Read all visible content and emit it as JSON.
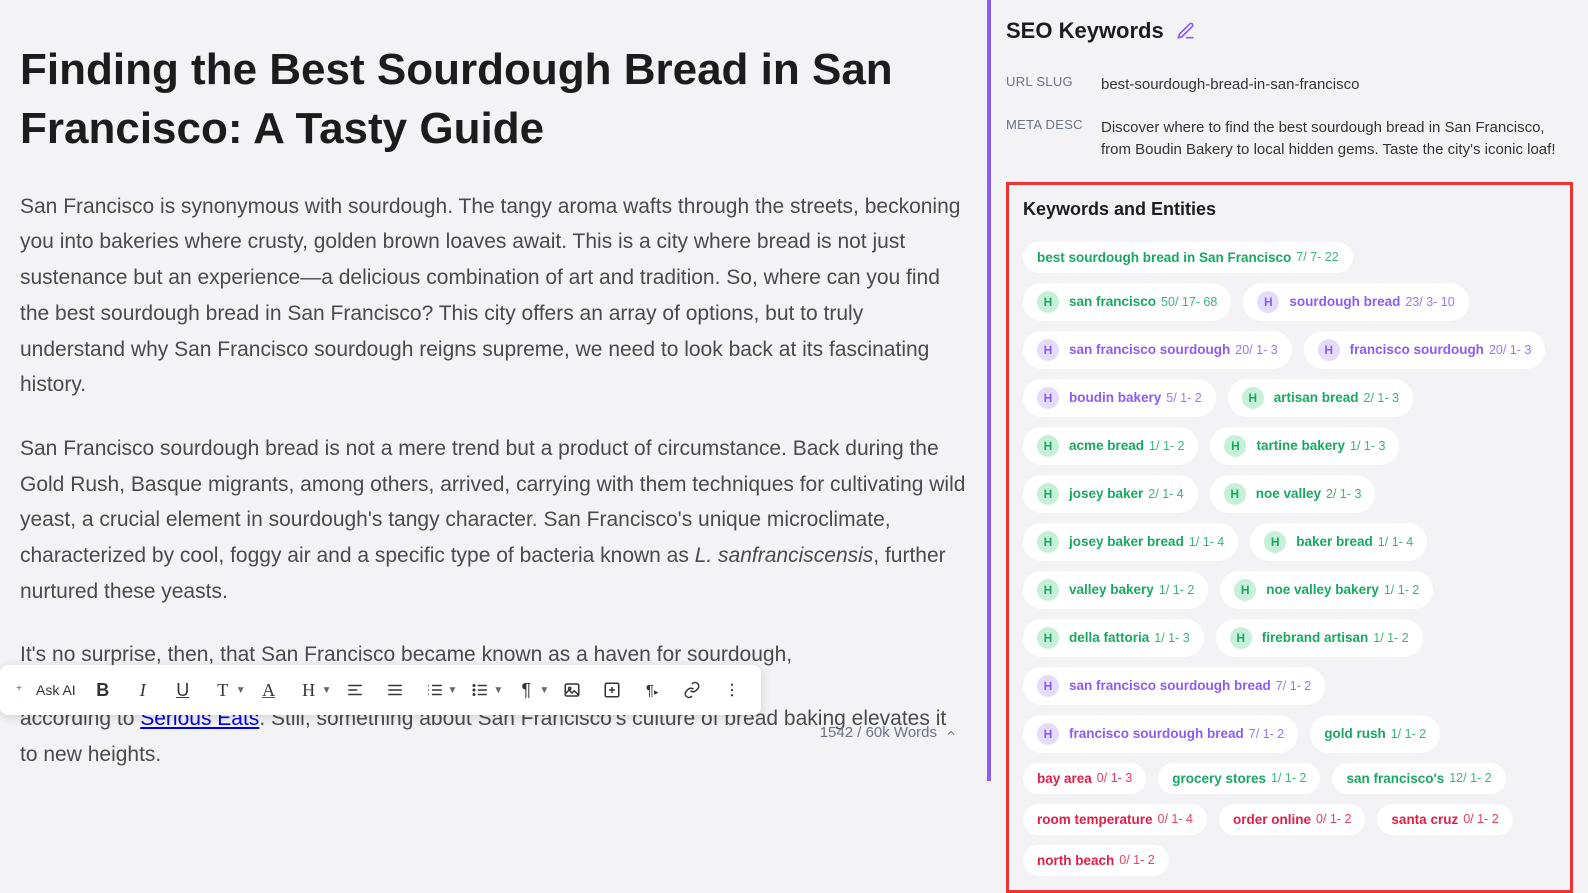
{
  "article": {
    "title": "Finding the Best Sourdough Bread in San Francisco: A Tasty Guide",
    "p1": "San Francisco is synonymous with sourdough. The tangy aroma wafts through the streets, beckoning you into bakeries where crusty, golden brown loaves await. This is a city where bread is not just sustenance but an experience—a delicious combination of art and tradition. So, where can you find the best sourdough bread in San Francisco? This city offers an array of options, but to truly understand why San Francisco sourdough reigns supreme, we need to look back at its fascinating history.",
    "p2a": "San Francisco sourdough bread is not a mere trend but a product of circumstance. Back during the Gold Rush, Basque migrants, among others, arrived, carrying with them techniques for cultivating wild yeast, a crucial element in sourdough's tangy character. San Francisco's unique microclimate, characterized by cool, foggy air and a specific type of bacteria known as ",
    "p2species": "L. sanfranciscensis",
    "p2b": ", further nurtured these yeasts.",
    "p3a": "It's no surprise, then, that San Francisco became known as a haven for sourdough,",
    "p3cut_a": "according to ",
    "p3link": "Serious Eats",
    "p3cut_b": ". Still, something about San Francisco's culture of bread baking elevates it to new heights."
  },
  "toolbar": {
    "ask_ai": "Ask AI",
    "bold": "B",
    "italic": "I",
    "underline": "U",
    "text_style": "T",
    "font": "A",
    "heading": "H",
    "pilcrow": "¶"
  },
  "word_count": "1542 / 60k Words",
  "seo": {
    "title": "SEO Keywords",
    "url_slug_label": "URL SLUG",
    "url_slug": "best-sourdough-bread-in-san-francisco",
    "meta_desc_label": "META DESC",
    "meta_desc": "Discover where to find the best sourdough bread in San Francisco, from Boudin Bakery to local hidden gems. Taste the city's iconic loaf!",
    "kw_title": "Keywords and Entities"
  },
  "keywords": [
    {
      "h": false,
      "c": "green",
      "term": "best sourdough bread in San Francisco",
      "stats": "7/ 7- 22"
    },
    {
      "h": true,
      "c": "green",
      "term": "san francisco",
      "stats": "50/ 17- 68"
    },
    {
      "h": true,
      "c": "purple",
      "term": "sourdough bread",
      "stats": "23/ 3- 10"
    },
    {
      "h": true,
      "c": "purple",
      "term": "san francisco sourdough",
      "stats": "20/ 1- 3"
    },
    {
      "h": true,
      "c": "purple",
      "term": "francisco sourdough",
      "stats": "20/ 1- 3"
    },
    {
      "h": true,
      "c": "purple",
      "term": "boudin bakery",
      "stats": "5/ 1- 2"
    },
    {
      "h": true,
      "c": "green",
      "term": "artisan bread",
      "stats": "2/ 1- 3"
    },
    {
      "h": true,
      "c": "green",
      "term": "acme bread",
      "stats": "1/ 1- 2"
    },
    {
      "h": true,
      "c": "green",
      "term": "tartine bakery",
      "stats": "1/ 1- 3"
    },
    {
      "h": true,
      "c": "green",
      "term": "josey baker",
      "stats": "2/ 1- 4"
    },
    {
      "h": true,
      "c": "green",
      "term": "noe valley",
      "stats": "2/ 1- 3"
    },
    {
      "h": true,
      "c": "green",
      "term": "josey baker bread",
      "stats": "1/ 1- 4"
    },
    {
      "h": true,
      "c": "green",
      "term": "baker bread",
      "stats": "1/ 1- 4"
    },
    {
      "h": true,
      "c": "green",
      "term": "valley bakery",
      "stats": "1/ 1- 2"
    },
    {
      "h": true,
      "c": "green",
      "term": "noe valley bakery",
      "stats": "1/ 1- 2"
    },
    {
      "h": true,
      "c": "green",
      "term": "della fattoria",
      "stats": "1/ 1- 3"
    },
    {
      "h": true,
      "c": "green",
      "term": "firebrand artisan",
      "stats": "1/ 1- 2"
    },
    {
      "h": true,
      "c": "purple",
      "term": "san francisco sourdough bread",
      "stats": "7/ 1- 2"
    },
    {
      "h": true,
      "c": "purple",
      "term": "francisco sourdough bread",
      "stats": "7/ 1- 2"
    },
    {
      "h": false,
      "c": "green",
      "term": "gold rush",
      "stats": "1/ 1- 2"
    },
    {
      "h": false,
      "c": "red",
      "term": "bay area",
      "stats": "0/ 1- 3"
    },
    {
      "h": false,
      "c": "green",
      "term": "grocery stores",
      "stats": "1/ 1- 2"
    },
    {
      "h": false,
      "c": "green",
      "term": "san francisco's",
      "stats": "12/ 1- 2"
    },
    {
      "h": false,
      "c": "red",
      "term": "room temperature",
      "stats": "0/ 1- 4"
    },
    {
      "h": false,
      "c": "red",
      "term": "order online",
      "stats": "0/ 1- 2"
    },
    {
      "h": false,
      "c": "red",
      "term": "santa cruz",
      "stats": "0/ 1- 2"
    },
    {
      "h": false,
      "c": "red",
      "term": "north beach",
      "stats": "0/ 1- 2"
    }
  ]
}
